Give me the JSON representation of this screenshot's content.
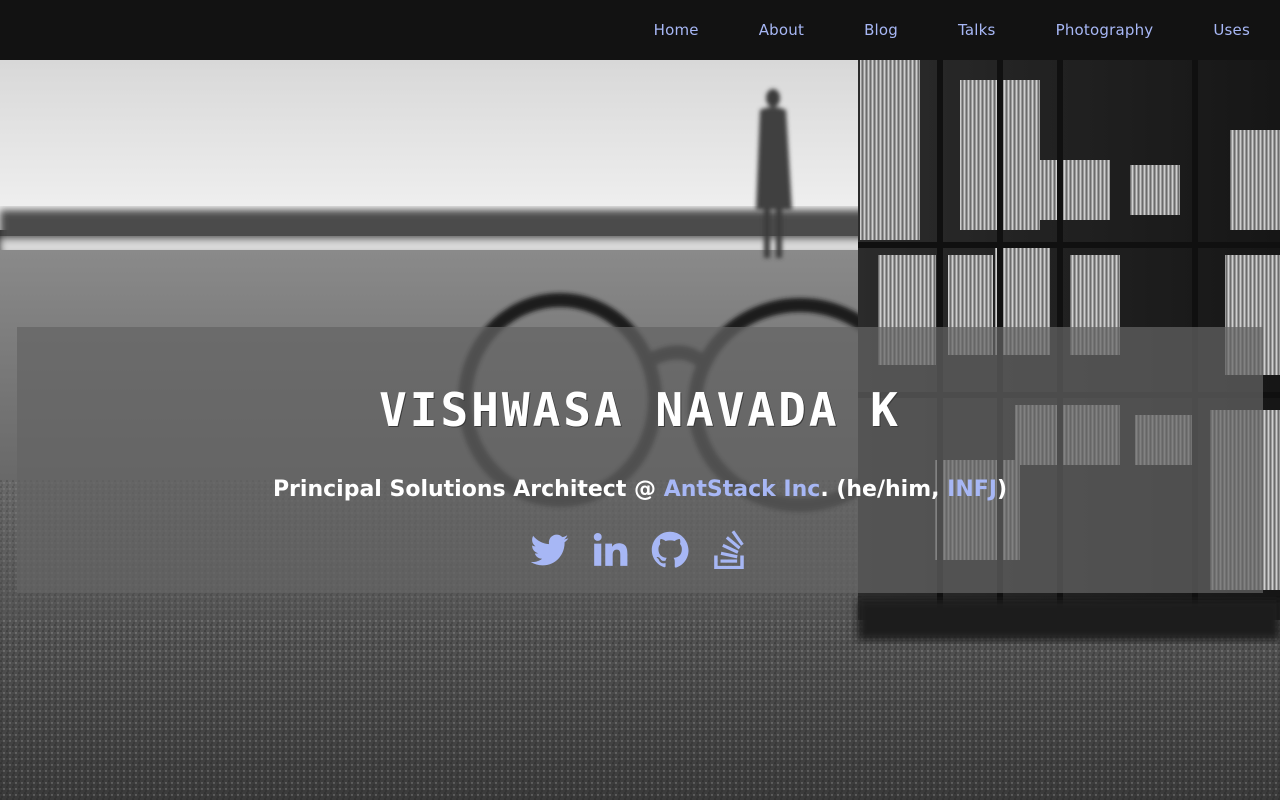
{
  "nav": {
    "items": [
      {
        "label": "Home"
      },
      {
        "label": "About"
      },
      {
        "label": "Blog"
      },
      {
        "label": "Talks"
      },
      {
        "label": "Photography"
      },
      {
        "label": "Uses"
      }
    ]
  },
  "hero": {
    "background": "black-and-white photo: glasses and a wooden puzzle cube on sand, person on shore",
    "title": "VISHWASA NAVADA K",
    "tagline": {
      "prefix": "Principal Solutions Architect @ ",
      "company_link": "AntStack Inc",
      "middle": ". (he/him, ",
      "mbti_link": "INFJ",
      "suffix": ")"
    },
    "social": [
      {
        "name": "twitter",
        "icon": "twitter-icon"
      },
      {
        "name": "linkedin",
        "icon": "linkedin-icon"
      },
      {
        "name": "github",
        "icon": "github-icon"
      },
      {
        "name": "stackoverflow",
        "icon": "stackoverflow-icon"
      }
    ]
  },
  "colors": {
    "nav_bg": "#121212",
    "link": "#a7b7f5",
    "panel": "rgba(100,100,100,0.72)",
    "title": "#ffffff"
  }
}
